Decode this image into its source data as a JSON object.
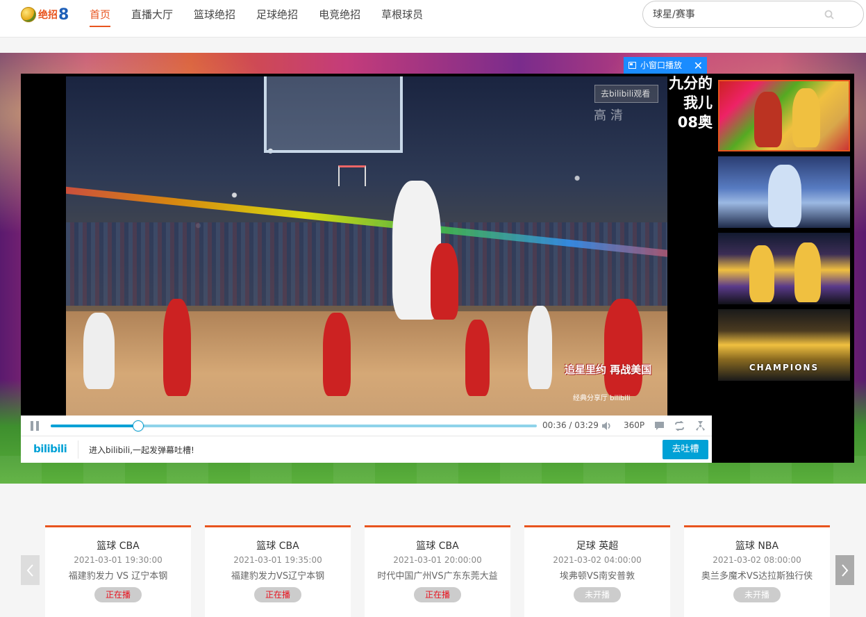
{
  "header": {
    "logo_text": "绝招",
    "logo_num": "8",
    "nav": [
      {
        "label": "首页",
        "active": true
      },
      {
        "label": "直播大厅",
        "active": false
      },
      {
        "label": "篮球绝招",
        "active": false
      },
      {
        "label": "足球绝招",
        "active": false
      },
      {
        "label": "电竞绝招",
        "active": false
      },
      {
        "label": "草根球员",
        "active": false
      }
    ],
    "search_placeholder": "球星/赛事"
  },
  "player": {
    "mini_window_label": "小窗口播放",
    "overlay_button": "去bilibili观看",
    "watermark": "高清",
    "subtitle": "追星里约 再战美国",
    "subtitle_small": "经典分享厅 bilibili",
    "danmaku_lines": [
      "九分的",
      "我儿",
      "08奥"
    ],
    "thumbnails": [
      {
        "label": "",
        "active": true
      },
      {
        "label": "",
        "active": false
      },
      {
        "label": "",
        "active": false
      },
      {
        "label": "CHAMPIONS",
        "active": false
      }
    ],
    "controls": {
      "current_time": "00:36",
      "separator": "/",
      "duration": "03:29",
      "progress_fraction": 0.18,
      "quality": "360P"
    },
    "danmaku_bar": {
      "logo": "bilibili",
      "hint": "进入bilibili,一起发弹幕吐槽!",
      "send_label": "去吐槽"
    }
  },
  "schedule": [
    {
      "title": "篮球 CBA",
      "time": "2021-03-01 19:30:00",
      "teams": "福建豹发力 VS 辽宁本钢",
      "status": "正在播",
      "live": true
    },
    {
      "title": "篮球 CBA",
      "time": "2021-03-01 19:35:00",
      "teams": "福建豹发力VS辽宁本钢",
      "status": "正在播",
      "live": true
    },
    {
      "title": "篮球 CBA",
      "time": "2021-03-01 20:00:00",
      "teams": "时代中国广州VS广东东莞大益",
      "status": "正在播",
      "live": true
    },
    {
      "title": "足球 英超",
      "time": "2021-03-02 04:00:00",
      "teams": "埃弗顿VS南安普敦",
      "status": "未开播",
      "live": false
    },
    {
      "title": "篮球 NBA",
      "time": "2021-03-02 08:00:00",
      "teams": "奥兰多魔术VS达拉斯独行侠",
      "status": "未开播",
      "live": false
    }
  ],
  "colors": {
    "accent": "#e8541e",
    "bili_blue": "#00a1d6",
    "mini_window_blue": "#1a8cff"
  }
}
